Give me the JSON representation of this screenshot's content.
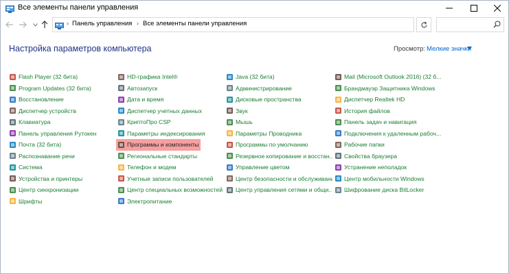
{
  "window": {
    "title": "Все элементы панели управления",
    "controls": {
      "minimize": "minimize",
      "maximize": "maximize",
      "close": "close"
    }
  },
  "address": {
    "crumbs": [
      "Панель управления",
      "Все элементы панели управления"
    ],
    "search_placeholder": ""
  },
  "header": {
    "title": "Настройка параметров компьютера",
    "view_label": "Просмотр:",
    "view_value": "Мелкие значки"
  },
  "colors": {
    "link_green": "#1a7d32",
    "title_blue": "#1e3287",
    "accent_blue": "#0066cc",
    "highlight": "#f6a0a0"
  },
  "columns": [
    {
      "items": [
        {
          "label": "Flash Player (32 бита)",
          "icon": "flash-icon"
        },
        {
          "label": "Program Updates (32 бита)",
          "icon": "updates-icon"
        },
        {
          "label": "Восстановление",
          "icon": "recovery-icon"
        },
        {
          "label": "Диспетчер устройств",
          "icon": "device-manager-icon"
        },
        {
          "label": "Клавиатура",
          "icon": "keyboard-icon"
        },
        {
          "label": "Панель управления Рутокен",
          "icon": "rutoken-icon"
        },
        {
          "label": "Почта (32 бита)",
          "icon": "mail-icon"
        },
        {
          "label": "Распознавание речи",
          "icon": "speech-icon"
        },
        {
          "label": "Система",
          "icon": "system-icon"
        },
        {
          "label": "Устройства и принтеры",
          "icon": "printer-icon"
        },
        {
          "label": "Центр синхронизации",
          "icon": "sync-icon"
        },
        {
          "label": "Шрифты",
          "icon": "fonts-icon"
        }
      ]
    },
    {
      "items": [
        {
          "label": "HD-графика Intel®",
          "icon": "intel-graphics-icon"
        },
        {
          "label": "Автозапуск",
          "icon": "autoplay-icon"
        },
        {
          "label": "Дата и время",
          "icon": "clock-icon"
        },
        {
          "label": "Диспетчер учетных данных",
          "icon": "credentials-icon"
        },
        {
          "label": "КриптоПро CSP",
          "icon": "cryptopro-icon"
        },
        {
          "label": "Параметры индексирования",
          "icon": "indexing-icon"
        },
        {
          "label": "Программы и компоненты",
          "icon": "programs-icon",
          "highlighted": true
        },
        {
          "label": "Региональные стандарты",
          "icon": "region-icon"
        },
        {
          "label": "Телефон и модем",
          "icon": "phone-icon"
        },
        {
          "label": "Учетные записи пользователей",
          "icon": "users-icon"
        },
        {
          "label": "Центр специальных возможностей",
          "icon": "accessibility-icon"
        },
        {
          "label": "Электропитание",
          "icon": "power-icon"
        }
      ]
    },
    {
      "items": [
        {
          "label": "Java (32 бита)",
          "icon": "java-icon"
        },
        {
          "label": "Администрирование",
          "icon": "admin-icon"
        },
        {
          "label": "Дисковые пространства",
          "icon": "storage-icon"
        },
        {
          "label": "Звук",
          "icon": "sound-icon"
        },
        {
          "label": "Мышь",
          "icon": "mouse-icon"
        },
        {
          "label": "Параметры Проводника",
          "icon": "folder-options-icon"
        },
        {
          "label": "Программы по умолчанию",
          "icon": "default-programs-icon"
        },
        {
          "label": "Резервное копирование и восстан...",
          "icon": "backup-icon"
        },
        {
          "label": "Управление цветом",
          "icon": "color-icon"
        },
        {
          "label": "Центр безопасности и обслуживания",
          "icon": "security-flag-icon"
        },
        {
          "label": "Центр управления сетями и общи...",
          "icon": "network-icon"
        }
      ]
    },
    {
      "items": [
        {
          "label": "Mail (Microsoft Outlook 2016) (32 б...",
          "icon": "outlook-mail-icon"
        },
        {
          "label": "Брандмауэр Защитника Windows",
          "icon": "firewall-icon"
        },
        {
          "label": "Диспетчер Realtek HD",
          "icon": "realtek-icon"
        },
        {
          "label": "История файлов",
          "icon": "file-history-icon"
        },
        {
          "label": "Панель задач и навигация",
          "icon": "taskbar-icon"
        },
        {
          "label": "Подключения к удаленным рабоч...",
          "icon": "remote-icon"
        },
        {
          "label": "Рабочие папки",
          "icon": "work-folders-icon"
        },
        {
          "label": "Свойства браузера",
          "icon": "browser-icon"
        },
        {
          "label": "Устранение неполадок",
          "icon": "troubleshoot-icon"
        },
        {
          "label": "Центр мобильности Windows",
          "icon": "mobility-icon"
        },
        {
          "label": "Шифрование диска BitLocker",
          "icon": "bitlocker-icon"
        }
      ]
    }
  ]
}
